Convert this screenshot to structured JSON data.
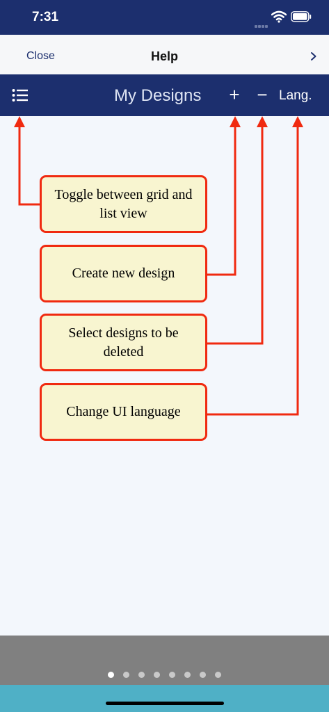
{
  "status_bar": {
    "time": "7:31"
  },
  "help_bar": {
    "close_label": "Close",
    "title": "Help",
    "next_label": "›"
  },
  "app_bar": {
    "title": "My Designs",
    "add_label": "+",
    "remove_label": "−",
    "lang_label": "Lang."
  },
  "callouts": [
    {
      "text": "Toggle between grid and list view",
      "target": "list-icon"
    },
    {
      "text": "Create new design",
      "target": "add-button"
    },
    {
      "text": "Select designs to be deleted",
      "target": "remove-button"
    },
    {
      "text": "Change UI language",
      "target": "lang-button"
    }
  ],
  "pager": {
    "total": 8,
    "current": 1
  },
  "colors": {
    "nav_bar": "#1c2f6e",
    "callout_border": "#f02a10",
    "callout_fill": "#f8f5d0",
    "footer": "#808080",
    "bottom_strip": "#4fb0c6"
  }
}
